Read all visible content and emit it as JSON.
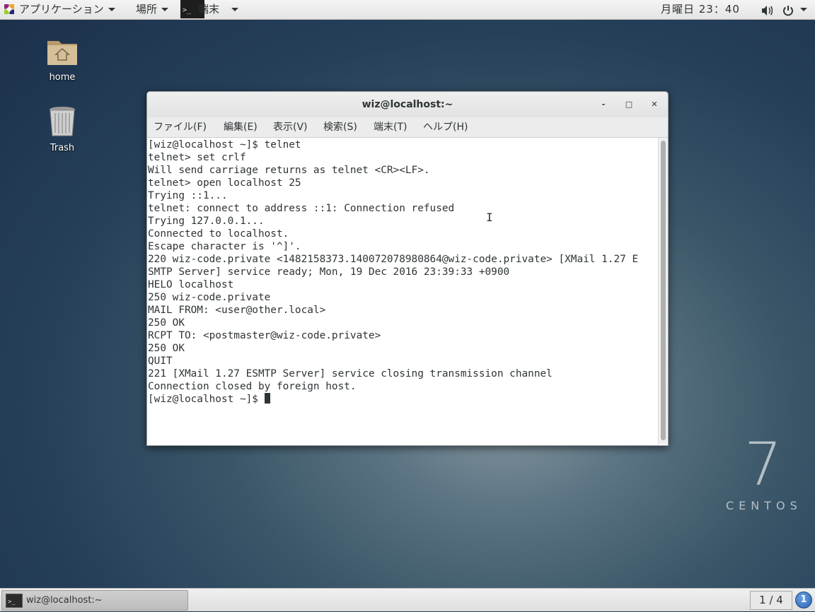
{
  "top_panel": {
    "applications_label": "アプリケーション",
    "places_label": "場所",
    "terminal_app_label": "端末",
    "clock": "月曜日 23：40"
  },
  "desktop": {
    "icons": [
      {
        "label": "home"
      },
      {
        "label": "Trash"
      }
    ],
    "logo": {
      "number": "7",
      "text": "CENTOS"
    }
  },
  "window": {
    "title": "wiz@localhost:~",
    "buttons": {
      "minimize": "-",
      "maximize": "□",
      "close": "✕"
    },
    "menu": {
      "file": "ファイル(F)",
      "edit": "編集(E)",
      "view": "表示(V)",
      "search": "検索(S)",
      "terminal": "端末(T)",
      "help": "ヘルプ(H)"
    },
    "lines": [
      "[wiz@localhost ~]$ telnet",
      "telnet> set crlf",
      "Will send carriage returns as telnet <CR><LF>.",
      "telnet> open localhost 25",
      "Trying ::1...",
      "telnet: connect to address ::1: Connection refused",
      "Trying 127.0.0.1...",
      "Connected to localhost.",
      "Escape character is '^]'.",
      "220 wiz-code.private <1482158373.140072078980864@wiz-code.private> [XMail 1.27 E",
      "SMTP Server] service ready; Mon, 19 Dec 2016 23:39:33 +0900",
      "HELO localhost",
      "250 wiz-code.private",
      "MAIL FROM: <user@other.local>",
      "250 OK",
      "RCPT TO: <postmaster@wiz-code.private>",
      "250 OK",
      "QUIT",
      "221 [XMail 1.27 ESMTP Server] service closing transmission channel",
      "Connection closed by foreign host.",
      "[wiz@localhost ~]$ "
    ]
  },
  "bottom_panel": {
    "taskbar_label": "wiz@localhost:~",
    "workspace": "1 / 4",
    "notifications": "1"
  }
}
